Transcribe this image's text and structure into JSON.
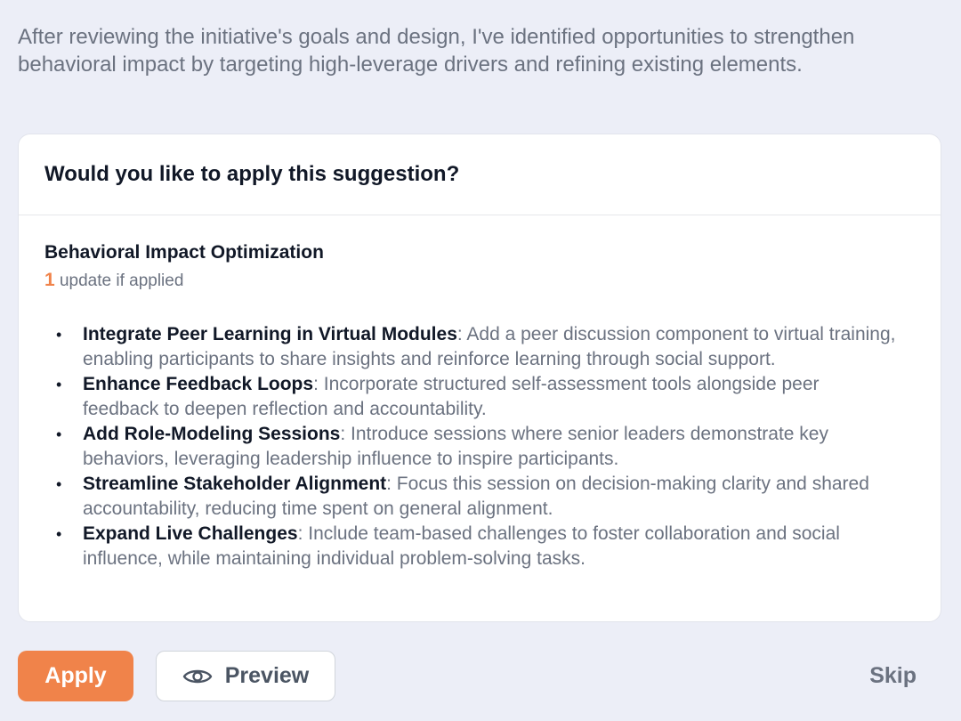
{
  "intro_text": "After reviewing the initiative's goals and design, I've identified opportunities to strengthen behavioral impact by targeting high-leverage drivers and refining existing elements.",
  "card": {
    "title": "Would you like to apply this suggestion?",
    "suggestion": {
      "title": "Behavioral Impact Optimization",
      "update_count": "1",
      "update_label": " update if applied",
      "items": [
        {
          "title": "Integrate Peer Learning in Virtual Modules",
          "description": ": Add a peer discussion component to virtual training, enabling participants to share insights and reinforce learning through social support."
        },
        {
          "title": "Enhance Feedback Loops",
          "description": ": Incorporate structured self-assessment tools alongside peer feedback to deepen reflection and accountability."
        },
        {
          "title": "Add Role-Modeling Sessions",
          "description": ": Introduce sessions where senior leaders demonstrate key behaviors, leveraging leadership influence to inspire participants."
        },
        {
          "title": "Streamline Stakeholder Alignment",
          "description": ": Focus this session on decision-making clarity and shared accountability, reducing time spent on general alignment."
        },
        {
          "title": "Expand Live Challenges",
          "description": ": Include team-based challenges to foster collaboration and social influence, while maintaining individual problem-solving tasks."
        }
      ]
    }
  },
  "actions": {
    "apply_label": "Apply",
    "preview_label": "Preview",
    "preview_icon": "eye-icon",
    "skip_label": "Skip"
  },
  "colors": {
    "accent": "#F0834A",
    "background": "#ECEEF7",
    "card": "#FFFFFF",
    "muted_text": "#6B7280",
    "strong_text": "#111827"
  }
}
